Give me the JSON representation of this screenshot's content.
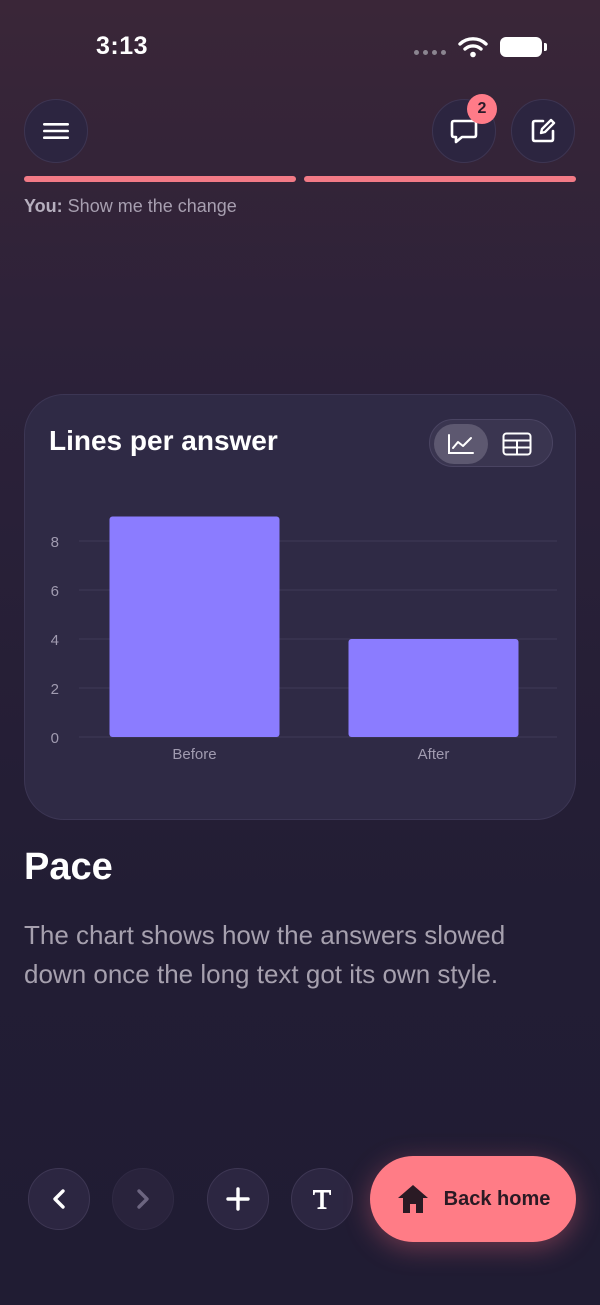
{
  "status_bar": {
    "time": "3:13"
  },
  "chat": {
    "badge_count": "2"
  },
  "progress": {
    "segments": 2,
    "filled": 2
  },
  "context": {
    "speaker": "You:",
    "message": "Show me the change"
  },
  "chart_data": {
    "type": "bar",
    "title": "Lines per answer",
    "categories": [
      "Before",
      "After"
    ],
    "values": [
      9,
      4
    ],
    "ylim": [
      0,
      9
    ],
    "yticks": [
      0,
      2,
      4,
      6,
      8
    ],
    "xlabel": "",
    "ylabel": "",
    "grid": true,
    "bar_color": "#8b7cff"
  },
  "section": {
    "title": "Pace",
    "body": "The chart shows how the answers slowed down once the long text got its own style."
  },
  "bottom_nav": {
    "home_label": "Back home"
  },
  "colors": {
    "accent": "#ff7c86",
    "progress": "#f27a86",
    "bar": "#8b7cff"
  }
}
